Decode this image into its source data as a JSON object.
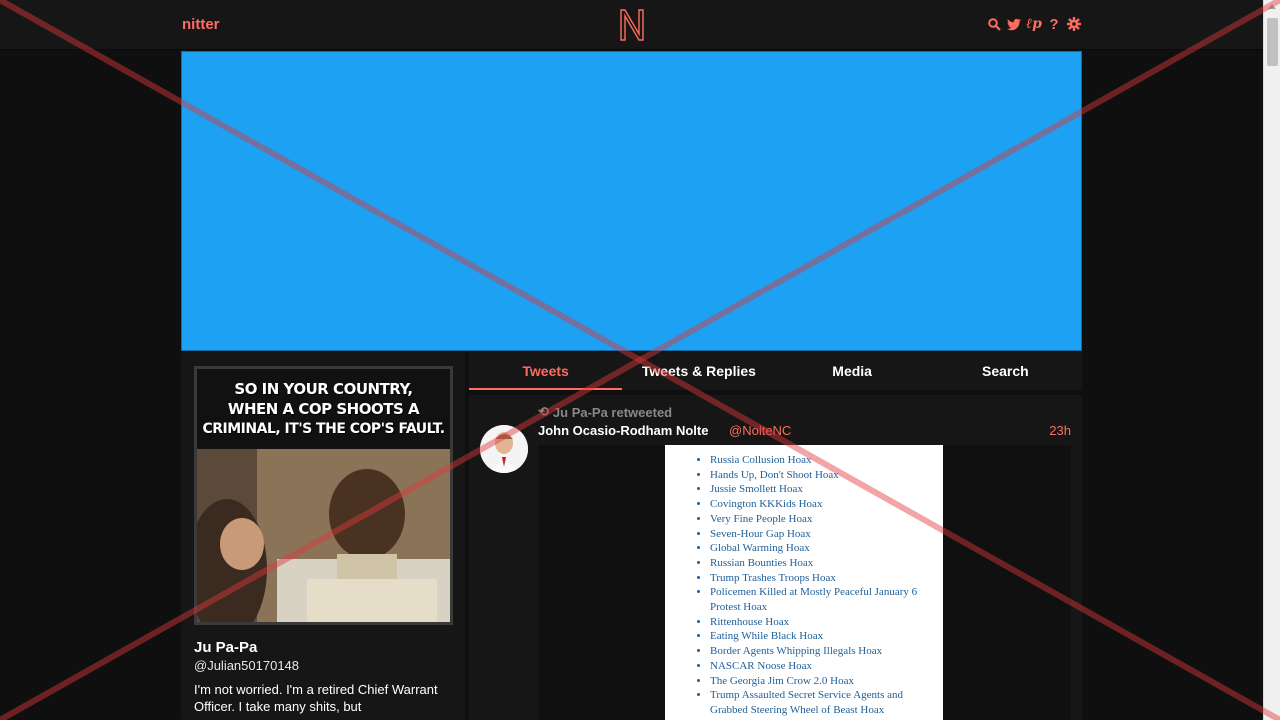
{
  "navbar": {
    "brand": "nitter",
    "icons": [
      "search-icon",
      "twitter-bird-icon",
      "rss-icon",
      "help-icon",
      "gear-icon"
    ]
  },
  "profile": {
    "avatar_caption_lines": [
      "SO IN YOUR COUNTRY,",
      "WHEN A COP SHOOTS A",
      "CRIMINAL, IT'S THE COP'S FAULT."
    ],
    "fullname": "Ju Pa-Pa",
    "username": "@Julian50170148",
    "bio": "I'm not worried. I'm a retired Chief Warrant Officer. I take many shits, but"
  },
  "tabs": [
    {
      "label": "Tweets",
      "active": true
    },
    {
      "label": "Tweets & Replies",
      "active": false
    },
    {
      "label": "Media",
      "active": false
    },
    {
      "label": "Search",
      "active": false
    }
  ],
  "tweet": {
    "retweet_header": "Ju Pa-Pa retweeted",
    "fullname": "John Ocasio-Rodham Nolte",
    "username": "@NolteNC",
    "date": "23h",
    "list_items": [
      "Russia Collusion Hoax",
      "Hands Up, Don't Shoot Hoax",
      "Jussie Smollett Hoax",
      "Covington KKKids Hoax",
      "Very Fine People Hoax",
      "Seven-Hour Gap Hoax",
      "Global Warming Hoax",
      "Russian Bounties Hoax",
      "Trump Trashes Troops Hoax",
      "Policemen Killed at Mostly Peaceful January 6 Protest Hoax",
      "Rittenhouse Hoax",
      "Eating While Black Hoax",
      "Border Agents Whipping Illegals Hoax",
      "NASCAR Noose Hoax",
      "The Georgia Jim Crow 2.0 Hoax",
      "Trump Assaulted Secret Service Agents and Grabbed Steering Wheel of Beast Hoax"
    ]
  },
  "colors": {
    "accent": "#ff6c60",
    "banner": "#1da1f2",
    "background": "#0f0f0f",
    "panel": "#161616"
  }
}
